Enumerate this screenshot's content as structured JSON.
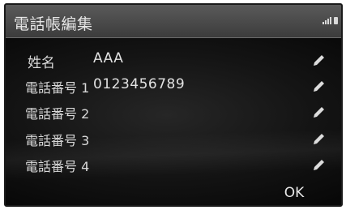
{
  "header": {
    "title": "電話帳編集",
    "status_icons": [
      "signal-icon",
      "battery-icon"
    ]
  },
  "fields": [
    {
      "label": "姓名",
      "value": "AAA",
      "edit_icon": "pencil-icon"
    },
    {
      "label": "電話番号 1",
      "value": "0123456789",
      "edit_icon": "pencil-icon"
    },
    {
      "label": "電話番号 2",
      "value": "",
      "edit_icon": "pencil-icon"
    },
    {
      "label": "電話番号 3",
      "value": "",
      "edit_icon": "pencil-icon"
    },
    {
      "label": "電話番号 4",
      "value": "",
      "edit_icon": "pencil-icon"
    }
  ],
  "footer": {
    "ok_label": "OK"
  },
  "colors": {
    "background": "#141414",
    "title_bar": "#4a4a4a",
    "text": "#e0e0e0"
  }
}
